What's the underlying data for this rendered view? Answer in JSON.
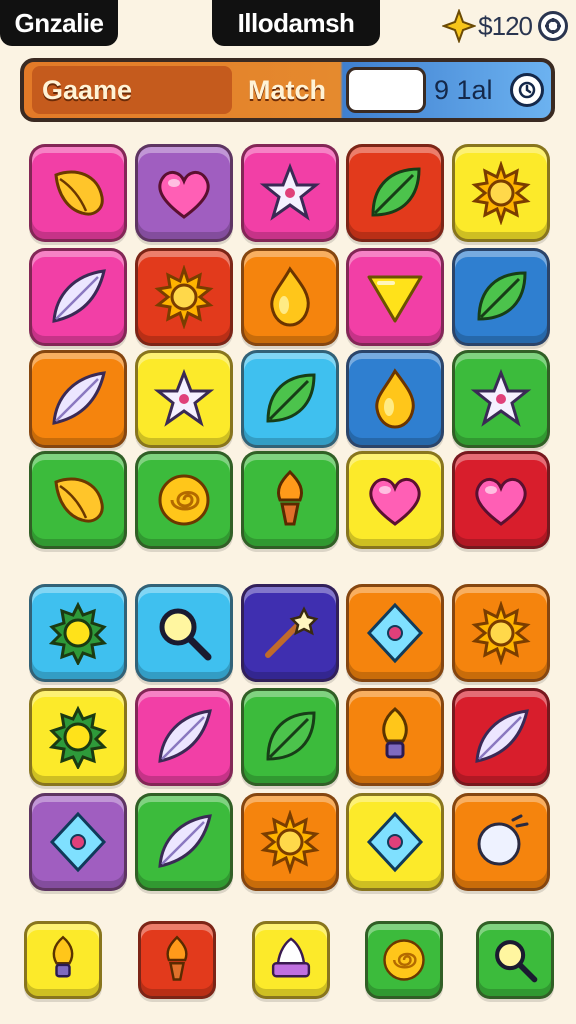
{
  "top_bar": {
    "left_tab": "Gnzalie",
    "center_tab": "Illodamsh",
    "currency_value": "$120"
  },
  "header": {
    "game_label": "Gaame",
    "match_label": "Match",
    "search_value": "",
    "stat_value": "9 1al"
  },
  "colors": {
    "pink": "#f23fa6",
    "purple": "#a05ec0",
    "red": "#e23a1c",
    "yellow": "#fcea2a",
    "blue": "#2f7fd0",
    "orange": "#f5840d",
    "cyan": "#3fc0ef",
    "green": "#3cbb3c",
    "crimson": "#d81e2c",
    "indigo": "#3f2fb0"
  },
  "board_top": [
    [
      {
        "bg": "pink",
        "icon": "shell-icon"
      },
      {
        "bg": "purple",
        "icon": "heart-icon"
      },
      {
        "bg": "pink",
        "icon": "star-icon"
      },
      {
        "bg": "red",
        "icon": "leaf-icon"
      },
      {
        "bg": "yellow",
        "icon": "sun-icon"
      }
    ],
    [
      {
        "bg": "pink",
        "icon": "feather-icon"
      },
      {
        "bg": "red",
        "icon": "sun-icon"
      },
      {
        "bg": "orange",
        "icon": "flame-icon"
      },
      {
        "bg": "pink",
        "icon": "triangle-icon"
      },
      {
        "bg": "blue",
        "icon": "leaf-icon"
      }
    ],
    [
      {
        "bg": "orange",
        "icon": "feather-icon"
      },
      {
        "bg": "yellow",
        "icon": "star-icon"
      },
      {
        "bg": "cyan",
        "icon": "leaf-icon"
      },
      {
        "bg": "blue",
        "icon": "flame-icon"
      },
      {
        "bg": "green",
        "icon": "star-icon"
      }
    ],
    [
      {
        "bg": "green",
        "icon": "shell-icon"
      },
      {
        "bg": "green",
        "icon": "swirl-icon"
      },
      {
        "bg": "green",
        "icon": "torch-icon"
      },
      {
        "bg": "yellow",
        "icon": "heart-icon"
      },
      {
        "bg": "crimson",
        "icon": "heart-icon"
      }
    ]
  ],
  "board_bottom": [
    [
      {
        "bg": "cyan",
        "icon": "gear-icon"
      },
      {
        "bg": "cyan",
        "icon": "magnifier-icon"
      },
      {
        "bg": "indigo",
        "icon": "wand-icon"
      },
      {
        "bg": "orange",
        "icon": "gem-icon"
      },
      {
        "bg": "orange",
        "icon": "sun-icon"
      }
    ],
    [
      {
        "bg": "yellow",
        "icon": "gear-icon"
      },
      {
        "bg": "pink",
        "icon": "feather-icon"
      },
      {
        "bg": "green",
        "icon": "leaf-icon"
      },
      {
        "bg": "orange",
        "icon": "bulb-icon"
      },
      {
        "bg": "crimson",
        "icon": "feather-icon"
      }
    ],
    [
      {
        "bg": "purple",
        "icon": "gem-icon"
      },
      {
        "bg": "green",
        "icon": "feather-icon"
      },
      {
        "bg": "orange",
        "icon": "sun-icon"
      },
      {
        "bg": "yellow",
        "icon": "gem-icon"
      },
      {
        "bg": "orange",
        "icon": "bubble-icon"
      }
    ]
  ],
  "powerups": [
    {
      "bg": "yellow",
      "icon": "bulb-icon"
    },
    {
      "bg": "red",
      "icon": "torch-icon"
    },
    {
      "bg": "yellow",
      "icon": "cake-icon"
    },
    {
      "bg": "green",
      "icon": "swirl-icon"
    },
    {
      "bg": "green",
      "icon": "magnifier-icon"
    }
  ]
}
